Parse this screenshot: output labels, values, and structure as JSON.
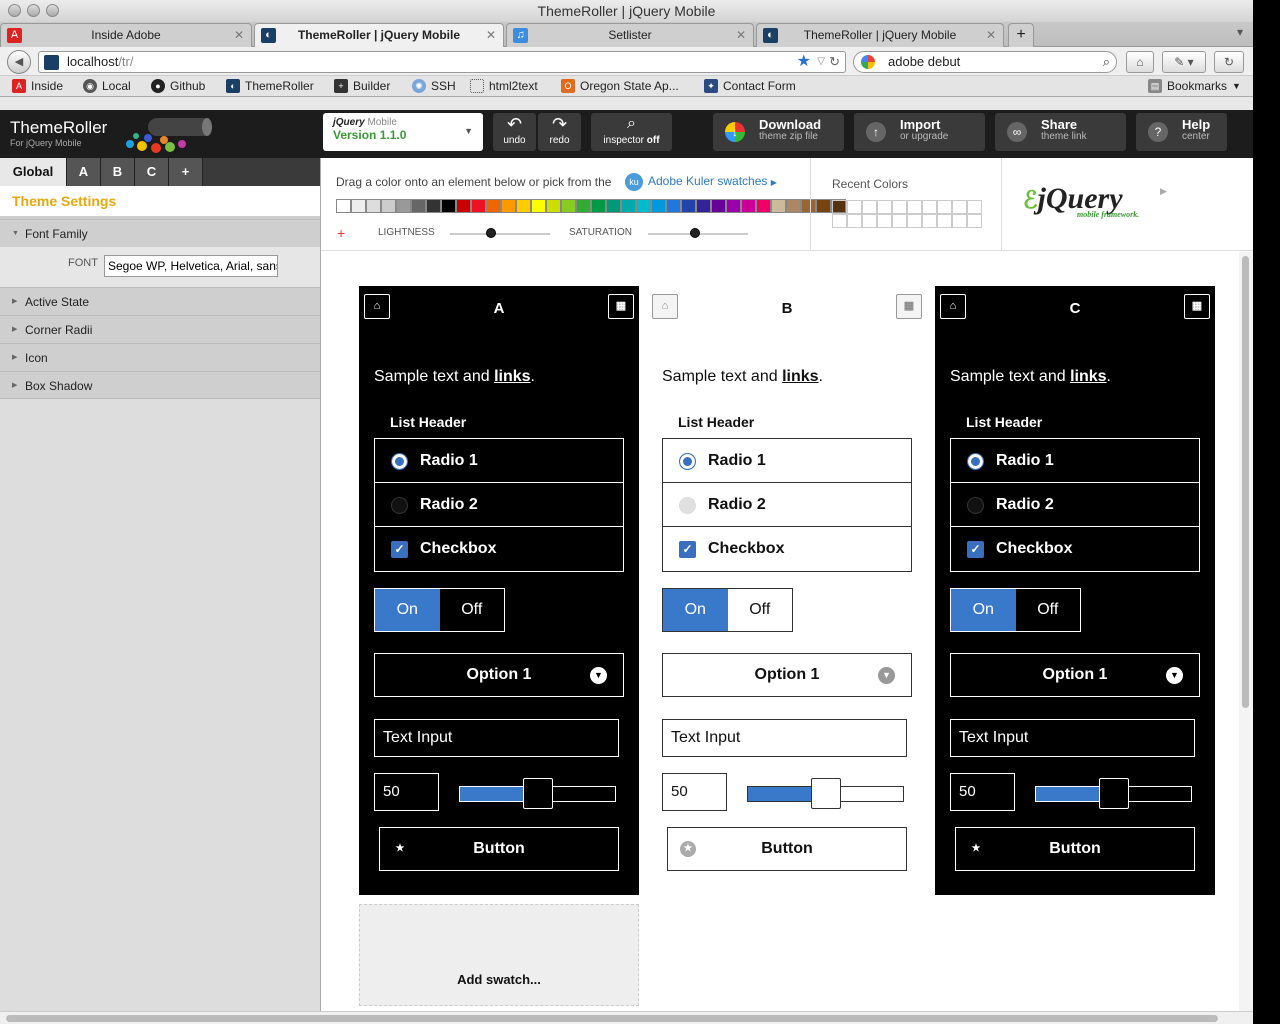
{
  "window": {
    "title": "ThemeRoller | jQuery Mobile"
  },
  "tabs": [
    {
      "label": "Inside Adobe",
      "icon": "adobe-icon"
    },
    {
      "label": "ThemeRoller | jQuery Mobile",
      "icon": "themeroller-icon",
      "active": true
    },
    {
      "label": "Setlister",
      "icon": "music-icon"
    },
    {
      "label": "ThemeRoller | jQuery Mobile",
      "icon": "themeroller-icon"
    }
  ],
  "nav": {
    "url_host": "localhost",
    "url_path": "/tr/",
    "search_value": "adobe debut"
  },
  "bookmarks": [
    {
      "label": "Inside",
      "icon": "adobe-icon"
    },
    {
      "label": "Local",
      "icon": "globe-icon"
    },
    {
      "label": "Github",
      "icon": "github-icon"
    },
    {
      "label": "ThemeRoller",
      "icon": "themeroller-icon"
    },
    {
      "label": "Builder",
      "icon": "plus-icon"
    },
    {
      "label": "SSH",
      "icon": "ssh-icon"
    },
    {
      "label": "html2text",
      "icon": "dotted-box-icon"
    },
    {
      "label": "Oregon State Ap...",
      "icon": "osu-icon"
    },
    {
      "label": "Contact Form",
      "icon": "star-icon"
    }
  ],
  "bookmarks_menu": "Bookmarks",
  "toolbar": {
    "logo_title": "ThemeRoller",
    "logo_sub": "For jQuery Mobile",
    "brand": "jQuery",
    "brand_mobile": "Mobile",
    "version": "Version 1.1.0",
    "undo": "undo",
    "redo": "redo",
    "inspector": "inspector",
    "inspector_state": "off",
    "download": "Download",
    "download_sub": "theme zip file",
    "import": "Import",
    "import_sub": "or upgrade",
    "share": "Share",
    "share_sub": "theme link",
    "help": "Help",
    "help_sub": "center"
  },
  "sidebar": {
    "tabs": [
      "Global",
      "A",
      "B",
      "C",
      "+"
    ],
    "heading": "Theme Settings",
    "font_section": "Font Family",
    "font_label": "FONT",
    "font_value": "Segoe WP, Helvetica, Arial, sans-serif",
    "sections": [
      "Active State",
      "Corner Radii",
      "Icon",
      "Box Shadow"
    ]
  },
  "picker": {
    "instruction": "Drag a color onto an element below or pick from the",
    "kuler": "Adobe Kuler swatches",
    "lightness": "LIGHTNESS",
    "saturation": "SATURATION",
    "lightness_value": 0.41,
    "saturation_value": 0.47,
    "recent": "Recent Colors",
    "colors": [
      "#ffffff",
      "#eeeeee",
      "#dddddd",
      "#cccccc",
      "#999999",
      "#666666",
      "#333333",
      "#000000",
      "#cc0000",
      "#ee1122",
      "#ee6600",
      "#ff9900",
      "#ffcc00",
      "#ffff00",
      "#ccdd00",
      "#88cc22",
      "#33aa33",
      "#009944",
      "#009977",
      "#00aaaa",
      "#00bbcc",
      "#0099dd",
      "#2277dd",
      "#2244aa",
      "#332299",
      "#660099",
      "#9900aa",
      "#cc0099",
      "#ee0066",
      "#ccbb99",
      "#aa8866",
      "#996633",
      "#774411",
      "#553311"
    ]
  },
  "jquery_logo": {
    "word": "jQuery",
    "tag": "mobile framework."
  },
  "swatches": [
    {
      "letter": "A",
      "theme": "dark"
    },
    {
      "letter": "B",
      "theme": "light"
    },
    {
      "letter": "C",
      "theme": "dark"
    }
  ],
  "preview": {
    "sample_text": "Sample text and",
    "link": "links",
    "list_header": "List Header",
    "radio1": "Radio 1",
    "radio2": "Radio 2",
    "checkbox": "Checkbox",
    "on": "On",
    "off": "Off",
    "select": "Option 1",
    "text_input": "Text Input",
    "slider_value": "50",
    "slider_fraction": 0.5,
    "button": "Button"
  },
  "add_swatch": "Add swatch..."
}
